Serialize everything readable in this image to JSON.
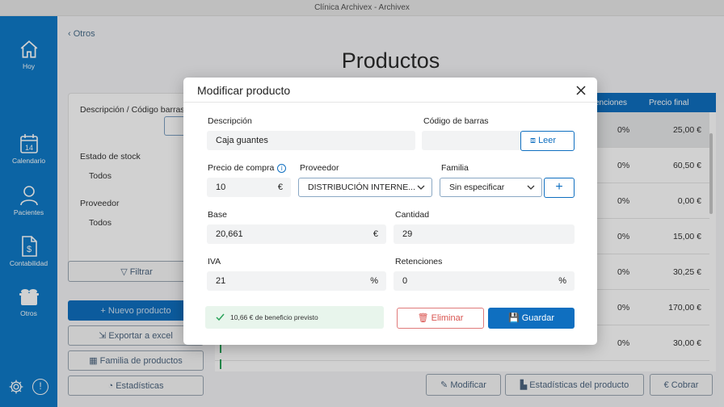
{
  "window": {
    "title": "Clínica Archivex - Archivex"
  },
  "sidebar": {
    "items": [
      {
        "label": "Hoy",
        "icon": "home-icon"
      },
      {
        "label": "Calendario",
        "icon": "calendar-icon",
        "badge": "14"
      },
      {
        "label": "Pacientes",
        "icon": "user-icon"
      },
      {
        "label": "Contabilidad",
        "icon": "invoice-icon"
      },
      {
        "label": "Otros",
        "icon": "boxes-icon"
      }
    ],
    "bottom": [
      {
        "icon": "gear-icon"
      },
      {
        "icon": "alert-icon",
        "text": "!"
      }
    ]
  },
  "main": {
    "back_label": "Otros",
    "page_title": "Productos",
    "filters": {
      "description_label": "Descripción / Código barras",
      "stock_label": "Estado de stock",
      "stock_value": "Todos",
      "provider_label": "Proveedor",
      "provider_value": "Todos",
      "filter_button": "Filtrar"
    },
    "actions": {
      "new_product": "Nuevo producto",
      "export_excel": "Exportar a excel",
      "product_family": "Familia de productos",
      "stats": "Estadísticas"
    },
    "table": {
      "headers": {
        "retenciones": "enciones",
        "precio_final": "Precio final"
      },
      "rows": [
        {
          "ret": "0%",
          "price": "25,00 €"
        },
        {
          "ret": "0%",
          "price": "60,50 €"
        },
        {
          "ret": "0%",
          "price": "0,00 €"
        },
        {
          "ret": "0%",
          "price": "15,00 €"
        },
        {
          "ret": "0%",
          "price": "30,25 €"
        },
        {
          "ret": "0%",
          "price": "170,00 €"
        },
        {
          "ret": "0%",
          "price": "30,00 €"
        }
      ]
    },
    "bottom_buttons": {
      "modify": "Modificar",
      "product_stats": "Estadísticas del producto",
      "charge": "Cobrar"
    }
  },
  "modal": {
    "title": "Modificar producto",
    "description_label": "Descripción",
    "description_value": "Caja guantes",
    "barcode_label": "Código de barras",
    "barcode_value": "",
    "read_button": "Leer",
    "purchase_price_label": "Precio de compra",
    "purchase_price_value": "10",
    "currency": "€",
    "provider_label": "Proveedor",
    "provider_value": "DISTRIBUCIÓN INTERNE...",
    "family_label": "Familia",
    "family_value": "Sin especificar",
    "base_label": "Base",
    "base_value": "20,661",
    "quantity_label": "Cantidad",
    "quantity_value": "29",
    "iva_label": "IVA",
    "iva_value": "21",
    "percent": "%",
    "retentions_label": "Retenciones",
    "retentions_value": "0",
    "profit_note": "10,66 € de beneficio previsto",
    "delete_button": "Eliminar",
    "save_button": "Guardar"
  },
  "colors": {
    "accent": "#0f6fc0",
    "sidebar": "#0f7bc8",
    "danger": "#d9534f",
    "success": "#2aa35a"
  }
}
